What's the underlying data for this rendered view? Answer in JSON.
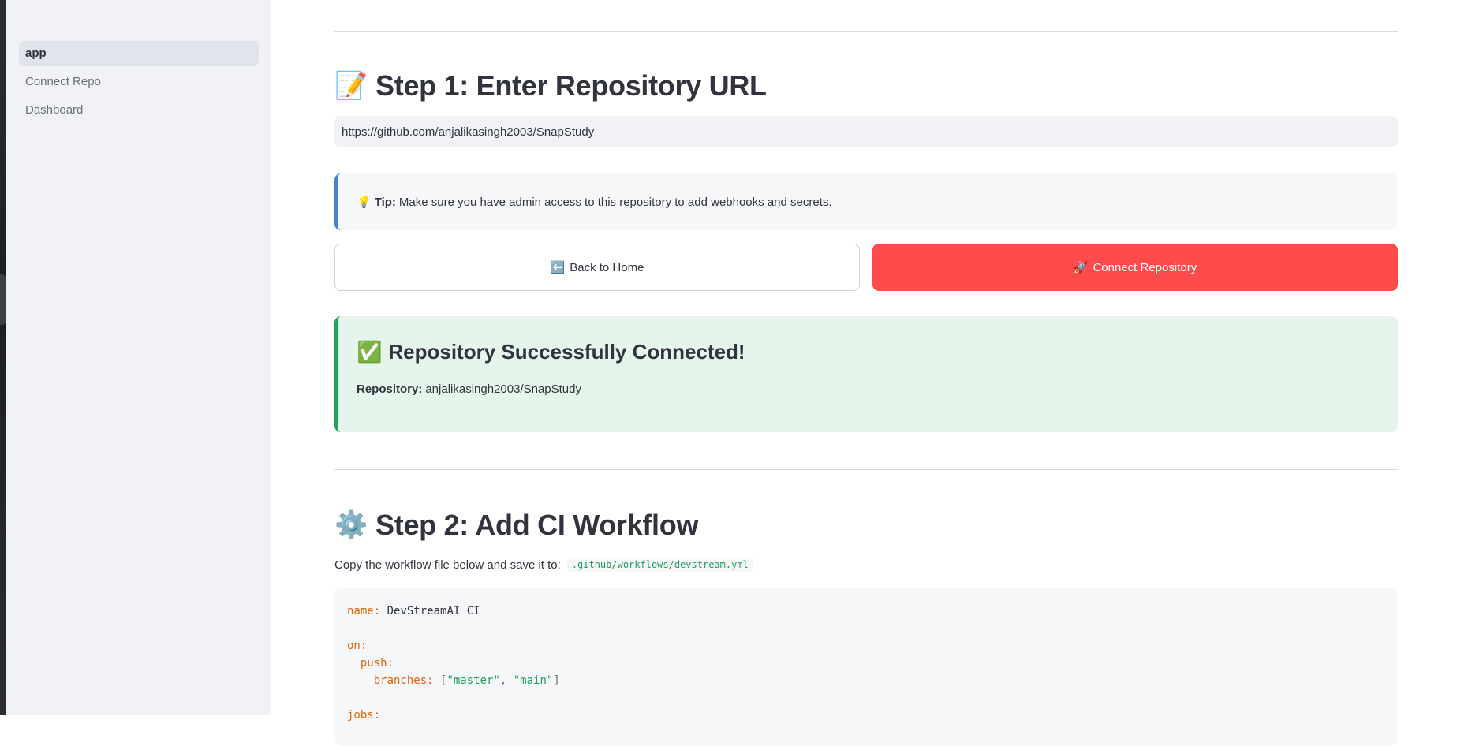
{
  "sidebar": {
    "items": [
      {
        "label": "app",
        "active": true
      },
      {
        "label": "Connect Repo",
        "active": false
      },
      {
        "label": "Dashboard",
        "active": false
      }
    ]
  },
  "step1": {
    "emoji": "📝",
    "title": "Step 1: Enter Repository URL",
    "repo_url": "https://github.com/anjalikasingh2003/SnapStudy"
  },
  "tip": {
    "icon": "💡",
    "label": "Tip:",
    "text": "Make sure you have admin access to this repository to add webhooks and secrets."
  },
  "buttons": {
    "back_icon": "⬅️",
    "back_label": "Back to Home",
    "connect_icon": "🚀",
    "connect_label": "Connect Repository"
  },
  "success": {
    "icon": "✅",
    "title": "Repository Successfully Connected!",
    "repo_label": "Repository:",
    "repo_value": "anjalikasingh2003/SnapStudy"
  },
  "step2": {
    "emoji": "⚙️",
    "title": "Step 2: Add CI Workflow",
    "instruction": "Copy the workflow file below and save it to:",
    "path": ".github/workflows/devstream.yml",
    "code": {
      "name_key": "name:",
      "name_value": "DevStreamAI CI",
      "on_key": "on:",
      "push_key": "push:",
      "branches_key": "branches:",
      "branch_1": "\"master\"",
      "branch_2": "\"main\"",
      "jobs_key": "jobs:"
    }
  },
  "colors": {
    "primary": "#ff4b4b",
    "success_bg": "#e5f5ec",
    "success_border": "#21a35d",
    "tip_border": "#4a7fd6",
    "sidebar_bg": "#f0f2f6"
  }
}
